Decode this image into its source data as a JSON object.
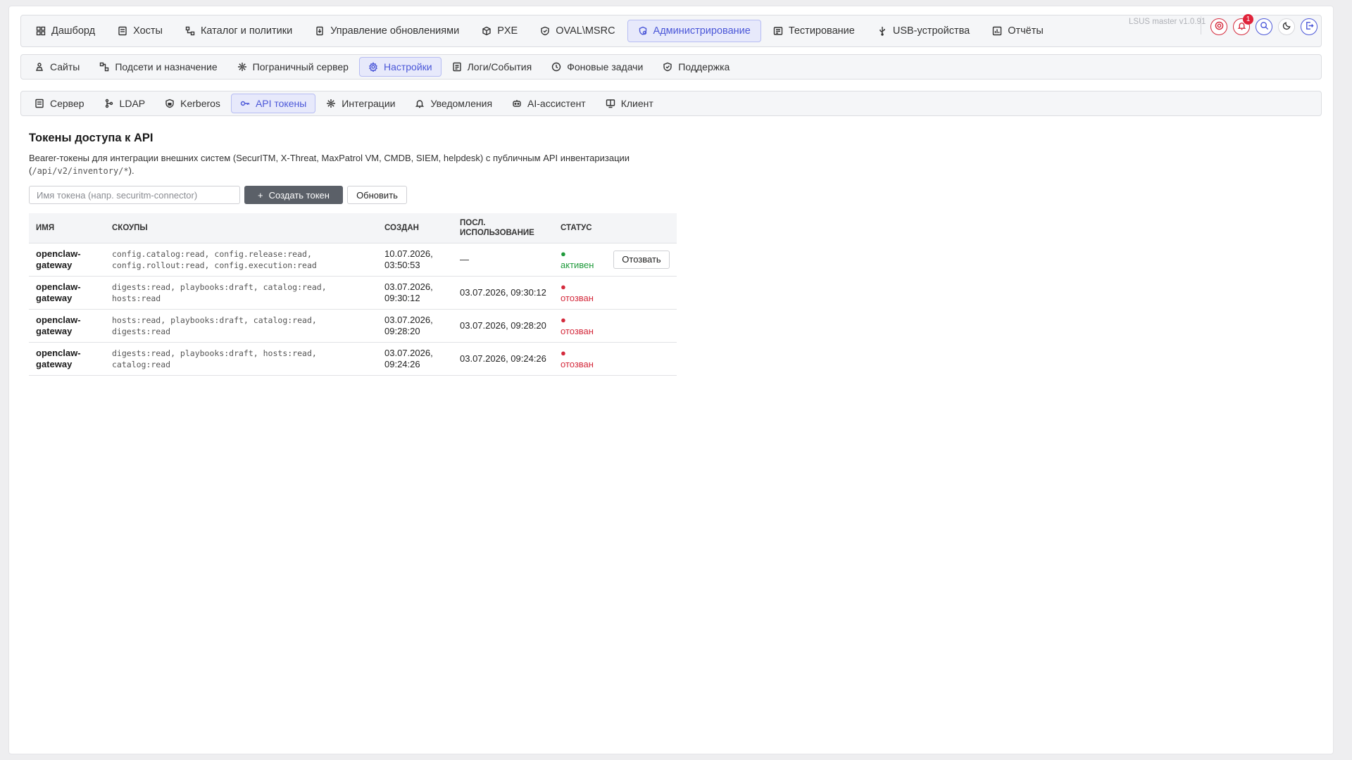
{
  "top_nav": {
    "items": [
      {
        "label": "Дашборд",
        "icon": "dashboard-icon"
      },
      {
        "label": "Хосты",
        "icon": "server-icon"
      },
      {
        "label": "Каталог и политики",
        "icon": "catalog-icon"
      },
      {
        "label": "Управление обновлениями",
        "icon": "update-icon"
      },
      {
        "label": "PXE",
        "icon": "box-icon"
      },
      {
        "label": "OVAL\\MSRC",
        "icon": "shield-icon"
      },
      {
        "label": "Администрирование",
        "icon": "admin-icon",
        "active": true
      },
      {
        "label": "Тестирование",
        "icon": "test-icon"
      },
      {
        "label": "USB-устройства",
        "icon": "usb-icon"
      },
      {
        "label": "Отчёты",
        "icon": "report-icon"
      }
    ],
    "version": "LSUS master v1.0.91",
    "notification_count": "1"
  },
  "sub_nav": {
    "items": [
      {
        "label": "Сайты",
        "icon": "sites-icon"
      },
      {
        "label": "Подсети и назначение",
        "icon": "subnet-icon"
      },
      {
        "label": "Пограничный сервер",
        "icon": "edge-server-icon"
      },
      {
        "label": "Настройки",
        "icon": "settings-icon",
        "active": true
      },
      {
        "label": "Логи/События",
        "icon": "logs-icon"
      },
      {
        "label": "Фоновые задачи",
        "icon": "clock-icon"
      },
      {
        "label": "Поддержка",
        "icon": "support-icon"
      }
    ]
  },
  "settings_nav": {
    "items": [
      {
        "label": "Сервер",
        "icon": "server-icon"
      },
      {
        "label": "LDAP",
        "icon": "ldap-icon"
      },
      {
        "label": "Kerberos",
        "icon": "kerberos-icon"
      },
      {
        "label": "API токены",
        "icon": "key-icon",
        "active": true
      },
      {
        "label": "Интеграции",
        "icon": "integrations-icon"
      },
      {
        "label": "Уведомления",
        "icon": "bell-icon"
      },
      {
        "label": "AI-ассистент",
        "icon": "bot-icon"
      },
      {
        "label": "Клиент",
        "icon": "client-icon"
      }
    ]
  },
  "page": {
    "title": "Токены доступа к API",
    "description_prefix": "Bearer-токены для интеграции внешних систем (SecurITM, X-Threat, MaxPatrol VM, CMDB, SIEM, helpdesk) с публичным API инвентаризации (",
    "description_code": "/api/v2/inventory/*",
    "description_suffix": ").",
    "token_input_placeholder": "Имя токена (напр. securitm-connector)",
    "create_button": "Создать токен",
    "refresh_button": "Обновить"
  },
  "table": {
    "headers": {
      "name": "Имя",
      "scopes": "Скоупы",
      "created": "Создан",
      "last_used": "Посл. использование",
      "status": "Статус"
    },
    "rows": [
      {
        "name": "openclaw-gateway",
        "scopes": "config.catalog:read, config.release:read, config.rollout:read, config.execution:read",
        "created": "10.07.2026, 03:50:53",
        "last_used": "—",
        "status": "активен",
        "state": "active",
        "action": "Отозвать"
      },
      {
        "name": "openclaw-gateway",
        "scopes": "digests:read, playbooks:draft, catalog:read, hosts:read",
        "created": "03.07.2026, 09:30:12",
        "last_used": "03.07.2026, 09:30:12",
        "status": "отозван",
        "state": "revoked",
        "action": ""
      },
      {
        "name": "openclaw-gateway",
        "scopes": "hosts:read, playbooks:draft, catalog:read, digests:read",
        "created": "03.07.2026, 09:28:20",
        "last_used": "03.07.2026, 09:28:20",
        "status": "отозван",
        "state": "revoked",
        "action": ""
      },
      {
        "name": "openclaw-gateway",
        "scopes": "digests:read, playbooks:draft, hosts:read, catalog:read",
        "created": "03.07.2026, 09:24:26",
        "last_used": "03.07.2026, 09:24:26",
        "status": "отозван",
        "state": "revoked",
        "action": ""
      }
    ]
  },
  "colors": {
    "accent": "#4b57d8",
    "active_status": "#1f9a3b",
    "revoked_status": "#d42a3c",
    "primary_button": "#5b6068"
  }
}
